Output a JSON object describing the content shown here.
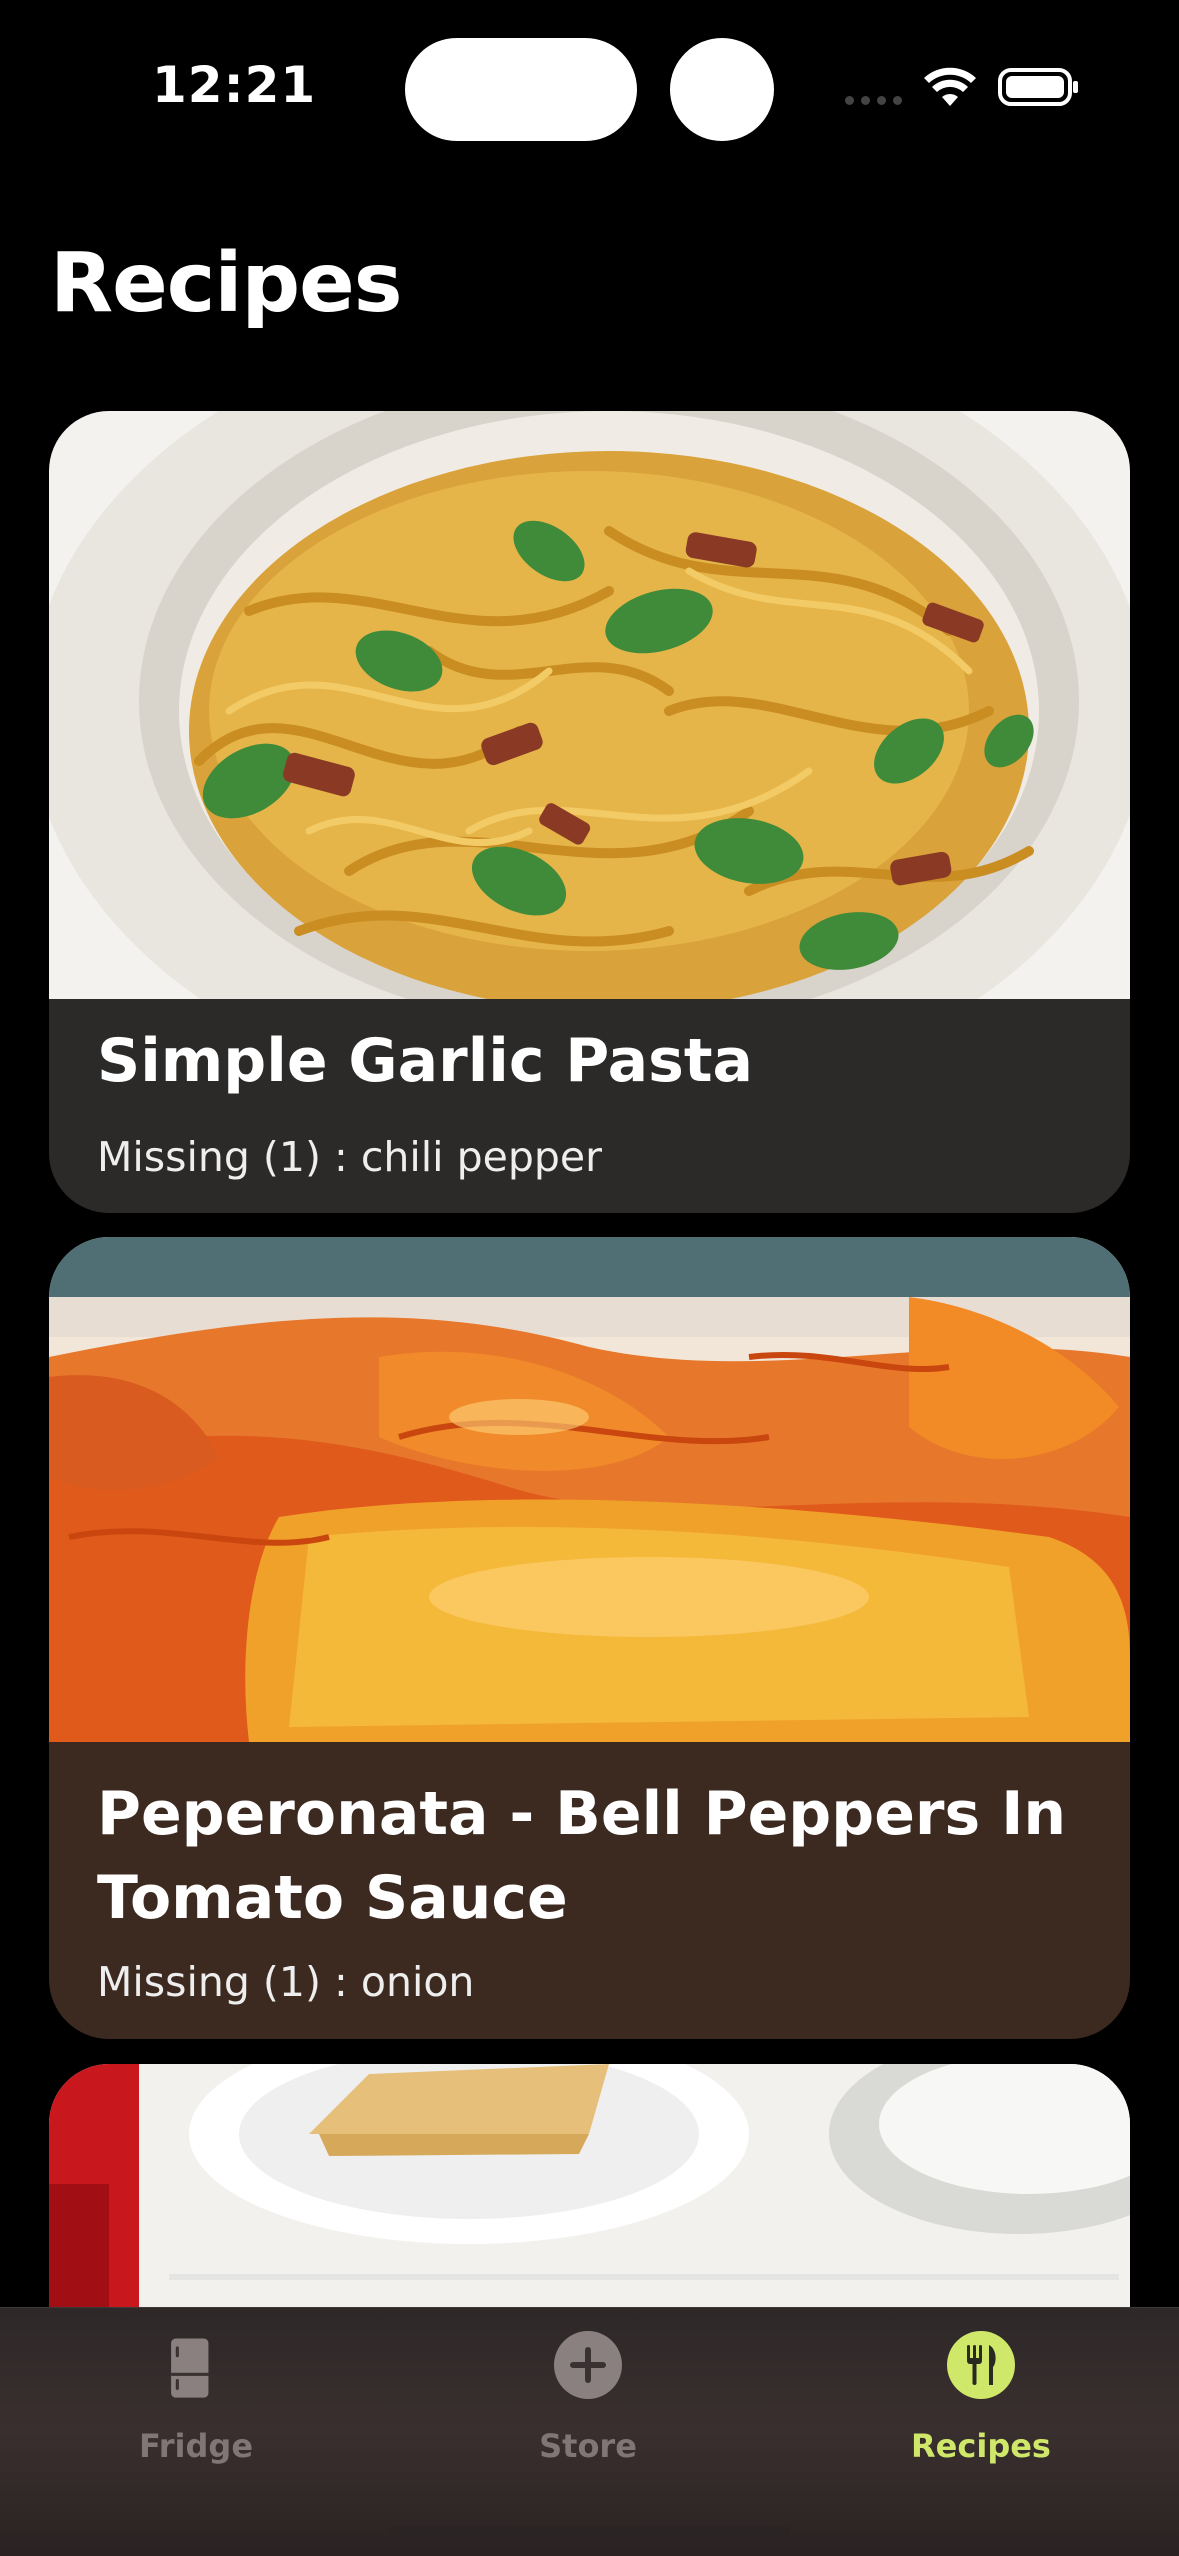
{
  "status_bar": {
    "time": "12:21"
  },
  "header": {
    "title": "Recipes"
  },
  "recipes": [
    {
      "title": "Simple Garlic Pasta",
      "missing": "Missing (1) : chili pepper"
    },
    {
      "title": "Peperonata - Bell Peppers In Tomato Sauce",
      "missing": "Missing (1) : onion"
    }
  ],
  "tab_bar": {
    "items": [
      {
        "label": "Fridge",
        "icon": "fridge-icon",
        "active": false
      },
      {
        "label": "Store",
        "icon": "plus-circle-icon",
        "active": false
      },
      {
        "label": "Recipes",
        "icon": "fork-knife-icon",
        "active": true
      }
    ]
  },
  "colors": {
    "background": "#000000",
    "active_tab": "#cfe86a",
    "inactive_tab": "#807676",
    "card_info_1": "#2b2a28",
    "card_info_2": "#3c2a20"
  }
}
